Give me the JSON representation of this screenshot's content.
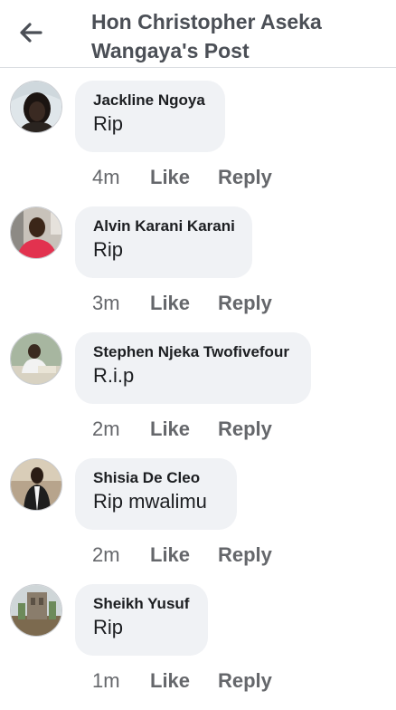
{
  "header": {
    "title_line1": "Hon Christopher Aseka",
    "title_line2": "Wangaya's Post",
    "back_icon": "arrow-left-icon"
  },
  "actions": {
    "like": "Like",
    "reply": "Reply"
  },
  "comments": [
    {
      "name": "Jackline Ngoya",
      "text": "Rip",
      "time": "4m"
    },
    {
      "name": "Alvin Karani Karani",
      "text": "Rip",
      "time": "3m"
    },
    {
      "name": "Stephen Njeka Twofivefour",
      "text": "R.i.p",
      "time": "2m"
    },
    {
      "name": "Shisia De Cleo",
      "text": "Rip mwalimu",
      "time": "2m"
    },
    {
      "name": "Sheikh Yusuf",
      "text": "Rip",
      "time": "1m"
    }
  ],
  "colors": {
    "bubble": "#f0f2f5",
    "meta": "#65676b",
    "title": "#4b4f56"
  }
}
